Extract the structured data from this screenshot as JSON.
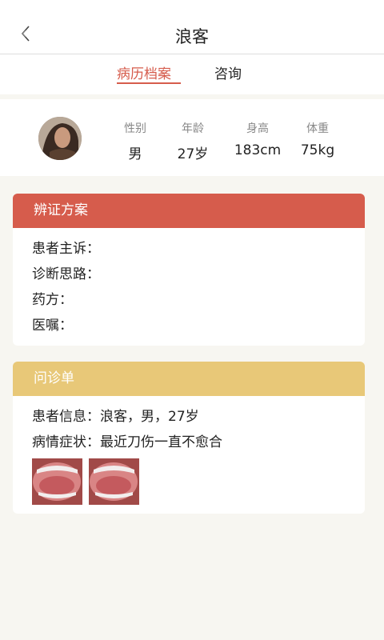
{
  "header": {
    "title": "浪客"
  },
  "tabs": [
    {
      "label": "病历档案",
      "active": true
    },
    {
      "label": "咨询",
      "active": false
    }
  ],
  "profile": {
    "stats": [
      {
        "label": "性别",
        "value": "男"
      },
      {
        "label": "年龄",
        "value": "27岁"
      },
      {
        "label": "身高",
        "value": "183cm"
      },
      {
        "label": "体重",
        "value": "75kg"
      }
    ]
  },
  "diagnosis": {
    "title": "辨证方案",
    "color": "#d65c4c",
    "rows": [
      "患者主诉：",
      "诊断思路：",
      "药方：",
      "医嘱："
    ]
  },
  "inquiry": {
    "title": "问诊单",
    "color": "#e8c878",
    "rows": [
      "患者信息：浪客，男，27岁",
      "病情症状：最近刀伤一直不愈合"
    ]
  },
  "colors": {
    "accent": "#d65c4c",
    "background": "#f7f6f1"
  },
  "icons": [
    "back-icon"
  ]
}
